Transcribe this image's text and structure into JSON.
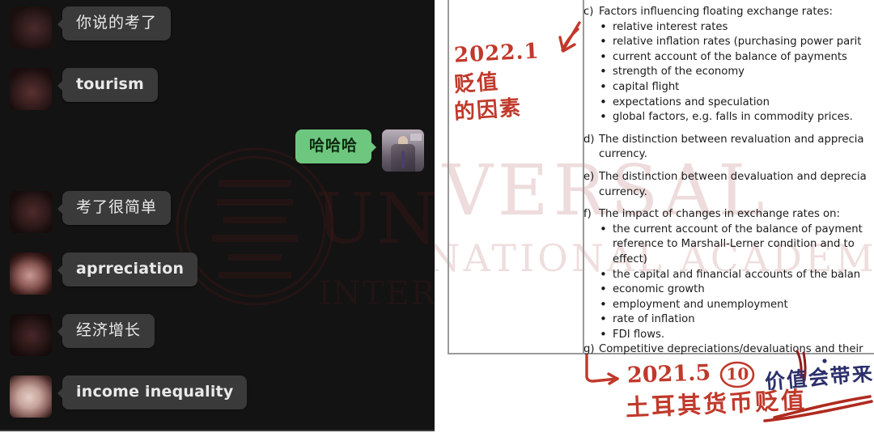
{
  "meta": {
    "left_panel_label": "wechat-chat-screenshot",
    "right_panel_label": "syllabus-document-scan",
    "watermark_line1": "UNIVERSAL",
    "watermark_line2": "INTERNATIONAL ACADEMY",
    "colors": {
      "chat_background": "#131313",
      "incoming_bubble": "#3a3a3a",
      "outgoing_bubble": "#6ec77f",
      "incoming_text": "#e9e9e9",
      "outgoing_text": "#0d2a12",
      "annotation_red": "#c0392b",
      "annotation_blue": "#2b2f6b",
      "document_text": "#1b1b1b",
      "table_border": "#9a9a9a"
    }
  },
  "chat": {
    "messages": [
      {
        "side": "left",
        "avatar": "av-a",
        "text": "你说的考了",
        "lang": "cn"
      },
      {
        "side": "left",
        "avatar": "av-b",
        "text": "tourism",
        "lang": "en"
      },
      {
        "side": "right",
        "avatar": "av-me",
        "text": "哈哈哈",
        "lang": "cn"
      },
      {
        "side": "left",
        "avatar": "av-c",
        "text": "考了很简单",
        "lang": "cn"
      },
      {
        "side": "left",
        "avatar": "av-d",
        "text": "aprreciation",
        "lang": "en"
      },
      {
        "side": "left",
        "avatar": "av-e",
        "text": "经济增长",
        "lang": "cn"
      },
      {
        "side": "left",
        "avatar": "av-f",
        "text": "income inequality",
        "lang": "en"
      }
    ]
  },
  "document": {
    "sections": [
      {
        "label": "c)",
        "text": "Factors influencing floating exchange rates:",
        "bullets": [
          "relative interest rates",
          "relative inflation rates (purchasing power parit",
          "current account of the balance of payments",
          "strength of the economy",
          "capital flight",
          "expectations and speculation",
          "global factors, e.g. falls in commodity prices."
        ]
      },
      {
        "label": "d)",
        "text": "The distinction between revaluation and apprecia",
        "text2": "currency.",
        "bullets": []
      },
      {
        "label": "e)",
        "text": "The distinction between devaluation and deprecia",
        "text2": "currency.",
        "bullets": []
      },
      {
        "label": "f)",
        "text": "The impact of changes in exchange rates on:",
        "bullets": [
          "the current account of the balance of payment",
          "the capital and financial accounts of the balan",
          "economic growth",
          "employment and unemployment",
          "rate of inflation",
          "FDI flows."
        ],
        "bullet0_line2": "reference to Marshall-Lerner condition and to",
        "bullet0_line3": "effect)"
      },
      {
        "label": "g)",
        "text": "Competitive depreciations/devaluations and their",
        "bullets": []
      }
    ]
  },
  "annotations": {
    "margin_note_date": "2022.1",
    "margin_note_line1": "贬值",
    "margin_note_line2": "的因素",
    "bottom_note_date": "2021.5",
    "bottom_note_badge": "10",
    "bottom_note_text": "土耳其货币贬值",
    "right_note_text": "价值会带来",
    "arrow_top": "arrow-pointing-down-left",
    "arrow_bottom": "arrow-pointing-right"
  }
}
